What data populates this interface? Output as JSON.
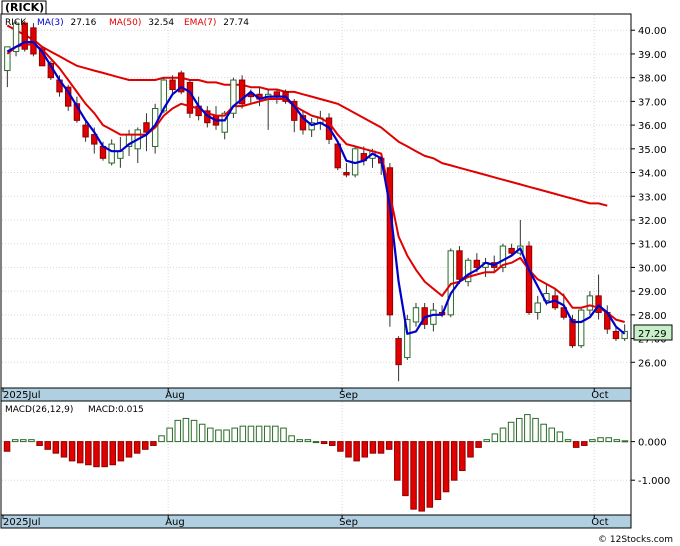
{
  "title_box": "(RICK)",
  "footer": "© 12Stocks.com",
  "chart_data": [
    {
      "type": "candlestick",
      "ticker": "RICK",
      "legend": {
        "ticker": "RICK",
        "items": [
          {
            "label": "MA(3)",
            "value": "27.16",
            "color": "#0000cc"
          },
          {
            "label": "MA(50)",
            "value": "32.54",
            "color": "#e00000"
          },
          {
            "label": "EMA(7)",
            "value": "27.74",
            "color": "#e00000"
          }
        ]
      },
      "ylim": [
        25.0,
        40.6
      ],
      "yticks": [
        "26.00",
        "27.00",
        "28.00",
        "29.00",
        "30.00",
        "31.00",
        "32.00",
        "33.00",
        "34.00",
        "35.00",
        "36.00",
        "37.00",
        "38.00",
        "39.00",
        "40.00"
      ],
      "last_price": "27.29",
      "x_labels": [
        {
          "label": "2025Jul",
          "index": 0
        },
        {
          "label": "Aug",
          "index": 19
        },
        {
          "label": "Sep",
          "index": 39
        },
        {
          "label": "Oct",
          "index": 68
        }
      ],
      "candles": [
        [
          38.3,
          39.3,
          37.6,
          39.3
        ],
        [
          39.1,
          40.4,
          38.9,
          40.3
        ],
        [
          40.3,
          40.4,
          39.1,
          39.2
        ],
        [
          40.1,
          40.3,
          38.9,
          39.0
        ],
        [
          39.2,
          39.3,
          38.5,
          38.5
        ],
        [
          38.6,
          38.7,
          37.9,
          38.0
        ],
        [
          37.9,
          38.1,
          37.2,
          37.4
        ],
        [
          37.6,
          37.7,
          36.6,
          36.8
        ],
        [
          36.9,
          37.2,
          36.1,
          36.2
        ],
        [
          36.0,
          36.2,
          35.3,
          35.5
        ],
        [
          35.6,
          35.9,
          34.8,
          35.2
        ],
        [
          35.1,
          35.3,
          34.5,
          34.6
        ],
        [
          34.4,
          35.4,
          34.3,
          35.2
        ],
        [
          34.6,
          35.5,
          34.2,
          34.9
        ],
        [
          35.1,
          35.8,
          34.7,
          35.6
        ],
        [
          35.0,
          35.9,
          34.4,
          35.8
        ],
        [
          36.1,
          36.5,
          34.9,
          35.7
        ],
        [
          35.1,
          36.9,
          34.8,
          36.7
        ],
        [
          36.6,
          38.0,
          36.5,
          37.9
        ],
        [
          37.9,
          38.1,
          37.3,
          37.5
        ],
        [
          38.2,
          38.3,
          37.3,
          37.4
        ],
        [
          37.8,
          37.9,
          36.3,
          36.5
        ],
        [
          36.8,
          37.2,
          36.2,
          36.4
        ],
        [
          36.6,
          36.8,
          35.9,
          36.1
        ],
        [
          36.4,
          36.8,
          35.8,
          36.0
        ],
        [
          35.7,
          36.6,
          35.4,
          36.5
        ],
        [
          36.5,
          38.0,
          36.3,
          37.9
        ],
        [
          37.9,
          38.1,
          36.7,
          36.9
        ],
        [
          37.3,
          37.5,
          36.9,
          37.2
        ],
        [
          37.3,
          37.6,
          36.8,
          37.1
        ],
        [
          37.1,
          37.5,
          35.8,
          37.3
        ],
        [
          37.4,
          37.5,
          36.9,
          37.2
        ],
        [
          37.4,
          37.5,
          36.9,
          37.0
        ],
        [
          37.0,
          37.1,
          35.7,
          36.2
        ],
        [
          36.4,
          36.6,
          35.6,
          35.8
        ],
        [
          35.8,
          36.3,
          35.5,
          36.1
        ],
        [
          36.1,
          36.6,
          35.8,
          36.3
        ],
        [
          36.3,
          36.5,
          35.2,
          35.4
        ],
        [
          35.2,
          35.3,
          34.1,
          34.2
        ],
        [
          34.0,
          34.4,
          33.8,
          33.9
        ],
        [
          33.9,
          35.1,
          33.8,
          35.0
        ],
        [
          34.8,
          35.1,
          34.3,
          34.5
        ],
        [
          34.6,
          35.0,
          34.2,
          34.9
        ],
        [
          34.6,
          34.7,
          33.9,
          34.4
        ],
        [
          34.2,
          34.4,
          27.5,
          28.0
        ],
        [
          27.0,
          27.1,
          25.2,
          25.9
        ],
        [
          26.2,
          28.0,
          26.1,
          27.8
        ],
        [
          27.7,
          28.5,
          27.5,
          28.3
        ],
        [
          28.3,
          28.5,
          27.4,
          27.6
        ],
        [
          27.6,
          28.5,
          27.3,
          28.2
        ],
        [
          28.1,
          28.4,
          27.9,
          28.0
        ],
        [
          28.0,
          30.8,
          27.9,
          30.7
        ],
        [
          30.7,
          30.9,
          29.3,
          29.5
        ],
        [
          29.4,
          30.4,
          29.2,
          30.3
        ],
        [
          30.3,
          30.6,
          29.8,
          30.0
        ],
        [
          30.0,
          30.4,
          29.6,
          30.2
        ],
        [
          30.2,
          30.5,
          29.8,
          30.0
        ],
        [
          30.0,
          31.0,
          29.8,
          30.9
        ],
        [
          30.8,
          31.0,
          30.5,
          30.6
        ],
        [
          30.6,
          32.0,
          30.5,
          30.9
        ],
        [
          30.9,
          31.1,
          28.0,
          28.1
        ],
        [
          28.1,
          28.8,
          27.8,
          28.5
        ],
        [
          28.6,
          29.3,
          28.4,
          28.9
        ],
        [
          28.8,
          29.1,
          28.2,
          28.3
        ],
        [
          28.3,
          28.9,
          27.8,
          27.9
        ],
        [
          27.8,
          28.0,
          26.6,
          26.7
        ],
        [
          26.7,
          28.3,
          26.6,
          28.2
        ],
        [
          28.2,
          29.0,
          28.0,
          28.8
        ],
        [
          28.8,
          29.7,
          27.8,
          28.1
        ],
        [
          28.1,
          28.4,
          27.2,
          27.4
        ],
        [
          27.3,
          27.5,
          26.9,
          27.0
        ],
        [
          27.0,
          27.6,
          26.9,
          27.3
        ]
      ],
      "ma3": [
        39.1,
        39.3,
        39.5,
        39.5,
        39.1,
        38.5,
        37.9,
        37.4,
        36.8,
        36.2,
        35.7,
        35.1,
        34.9,
        34.9,
        35.2,
        35.4,
        35.6,
        36.0,
        36.7,
        37.3,
        37.6,
        37.4,
        36.8,
        36.4,
        36.2,
        36.2,
        36.8,
        37.1,
        37.4,
        37.1,
        37.2,
        37.2,
        37.2,
        36.8,
        36.3,
        36.0,
        36.1,
        35.9,
        35.3,
        34.5,
        34.4,
        34.5,
        34.8,
        34.6,
        32.6,
        29.4,
        27.2,
        27.3,
        27.9,
        28.0,
        28.0,
        28.9,
        29.4,
        29.7,
        29.9,
        30.2,
        30.1,
        30.3,
        30.5,
        30.8,
        29.9,
        29.2,
        28.5,
        28.6,
        28.4,
        27.7,
        27.7,
        27.9,
        28.4,
        28.1,
        27.5,
        27.2
      ],
      "ema7": [
        39.0,
        39.3,
        39.4,
        39.4,
        39.2,
        38.8,
        38.4,
        37.9,
        37.4,
        36.9,
        36.5,
        36.0,
        35.8,
        35.6,
        35.6,
        35.6,
        35.6,
        35.9,
        36.4,
        36.7,
        36.9,
        36.8,
        36.7,
        36.5,
        36.4,
        36.4,
        36.8,
        36.8,
        36.9,
        37.0,
        37.1,
        37.1,
        37.1,
        36.8,
        36.6,
        36.4,
        36.3,
        36.1,
        35.6,
        35.2,
        35.1,
        35.0,
        34.9,
        34.8,
        33.1,
        31.3,
        30.5,
        29.9,
        29.4,
        29.1,
        28.8,
        29.3,
        29.4,
        29.6,
        29.7,
        29.8,
        29.8,
        30.1,
        30.2,
        30.4,
        29.9,
        29.5,
        29.3,
        29.1,
        28.8,
        28.3,
        28.3,
        28.4,
        28.3,
        28.1,
        27.8,
        27.7
      ],
      "ma50": [
        40.2,
        40.0,
        39.8,
        39.6,
        39.3,
        39.1,
        38.9,
        38.7,
        38.5,
        38.4,
        38.3,
        38.2,
        38.1,
        38.0,
        37.9,
        37.9,
        37.9,
        37.9,
        38.0,
        38.0,
        38.0,
        37.9,
        37.9,
        37.8,
        37.8,
        37.7,
        37.7,
        37.7,
        37.6,
        37.6,
        37.5,
        37.5,
        37.4,
        37.4,
        37.3,
        37.2,
        37.1,
        37.0,
        36.9,
        36.7,
        36.5,
        36.3,
        36.1,
        35.9,
        35.6,
        35.3,
        35.1,
        34.9,
        34.7,
        34.6,
        34.4,
        34.3,
        34.2,
        34.1,
        34.0,
        33.9,
        33.8,
        33.7,
        33.6,
        33.5,
        33.4,
        33.3,
        33.2,
        33.1,
        33.0,
        32.9,
        32.8,
        32.7,
        32.7,
        32.6
      ]
    },
    {
      "type": "bar",
      "legend": [
        {
          "label": "MACD(26,12,9)",
          "color": "#000000"
        },
        {
          "label": "MACD:0.015",
          "color": "#0000cc"
        }
      ],
      "ylim": [
        -1.85,
        1.0
      ],
      "yticks": [
        "0.000",
        "-1.000"
      ],
      "x_labels": [
        {
          "label": "2025Jul",
          "index": 0
        },
        {
          "label": "Aug",
          "index": 19
        },
        {
          "label": "Sep",
          "index": 39
        },
        {
          "label": "Oct",
          "index": 68
        }
      ],
      "values": [
        -0.25,
        0.05,
        0.05,
        0.05,
        -0.1,
        -0.2,
        -0.3,
        -0.4,
        -0.5,
        -0.55,
        -0.6,
        -0.65,
        -0.65,
        -0.6,
        -0.5,
        -0.4,
        -0.3,
        -0.2,
        -0.1,
        0.15,
        0.35,
        0.55,
        0.6,
        0.55,
        0.45,
        0.35,
        0.3,
        0.3,
        0.35,
        0.4,
        0.4,
        0.4,
        0.4,
        0.4,
        0.35,
        0.15,
        0.05,
        0.05,
        0.0,
        -0.05,
        -0.1,
        -0.25,
        -0.4,
        -0.5,
        -0.4,
        -0.3,
        -0.3,
        -0.2,
        -1.0,
        -1.4,
        -1.75,
        -1.8,
        -1.7,
        -1.5,
        -1.3,
        -1.0,
        -0.75,
        -0.4,
        -0.15,
        0.05,
        0.2,
        0.35,
        0.5,
        0.6,
        0.7,
        0.6,
        0.45,
        0.35,
        0.25,
        0.05,
        -0.15,
        -0.1,
        0.05,
        0.1,
        0.1,
        0.05,
        0.02
      ]
    }
  ]
}
